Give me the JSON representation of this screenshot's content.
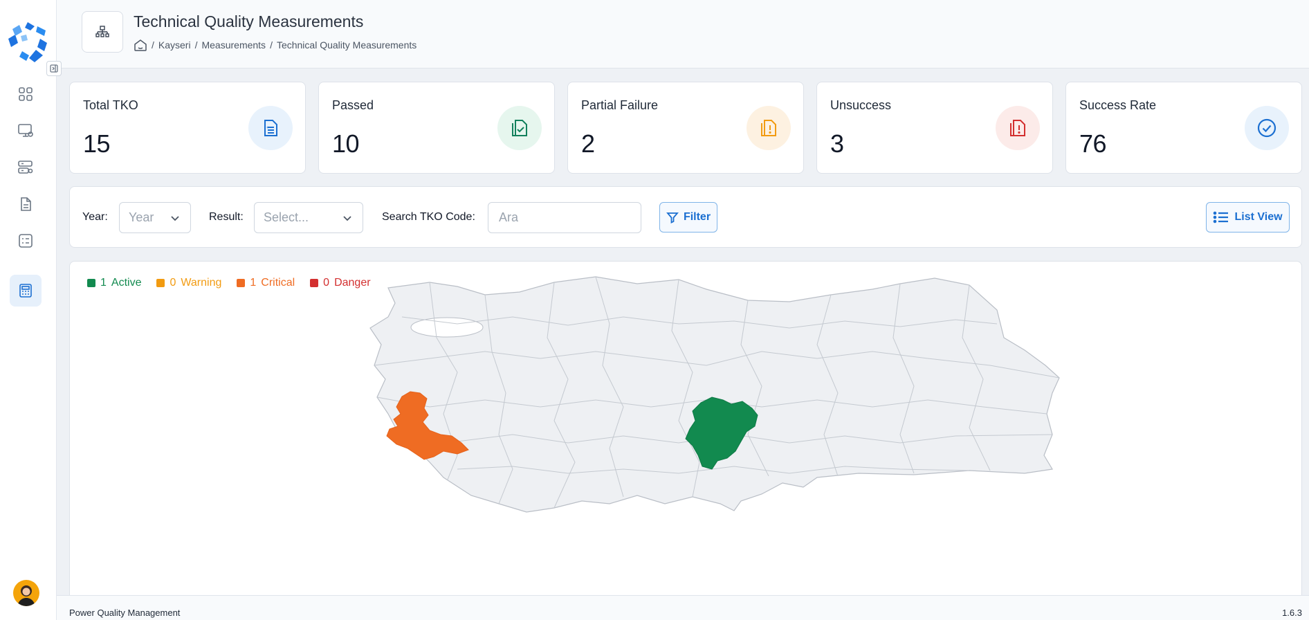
{
  "header": {
    "title": "Technical Quality Measurements",
    "breadcrumb": [
      "Kayseri",
      "Measurements",
      "Technical Quality Measurements"
    ],
    "separator": "/"
  },
  "stats": [
    {
      "label": "Total TKO",
      "value": "15",
      "icon": "document-list-icon",
      "color": "#1b6fd1",
      "bg": "#e8f2fc"
    },
    {
      "label": "Passed",
      "value": "10",
      "icon": "document-check-icon",
      "color": "#12805c",
      "bg": "#e6f6ee"
    },
    {
      "label": "Partial Failure",
      "value": "2",
      "icon": "document-warning-icon",
      "color": "#f29b11",
      "bg": "#fdf1e1"
    },
    {
      "label": "Unsuccess",
      "value": "3",
      "icon": "document-error-icon",
      "color": "#d32f2f",
      "bg": "#fcebe9"
    },
    {
      "label": "Success Rate",
      "value": "76",
      "icon": "check-circle-icon",
      "color": "#1b6fd1",
      "bg": "#e8f2fc"
    }
  ],
  "filters": {
    "year_label": "Year:",
    "year_placeholder": "Year",
    "result_label": "Result:",
    "result_placeholder": "Select...",
    "search_label": "Search TKO Code:",
    "search_placeholder": "Ara",
    "filter_button": "Filter",
    "list_view_button": "List View"
  },
  "legend": [
    {
      "count": "1",
      "label": "Active",
      "color": "#128a4f"
    },
    {
      "count": "0",
      "label": "Warning",
      "color": "#f29b11"
    },
    {
      "count": "1",
      "label": "Critical",
      "color": "#ef6c23"
    },
    {
      "count": "0",
      "label": "Danger",
      "color": "#d32f2f"
    }
  ],
  "map": {
    "highlighted_regions": [
      {
        "name": "Kayseri",
        "status": "Active",
        "color": "#128a4f"
      },
      {
        "name": "İzmir",
        "status": "Critical",
        "color": "#ef6c23"
      }
    ],
    "base_color": "#eef0f3",
    "border_color": "#b9bec6"
  },
  "sidebar": {
    "items": [
      {
        "name": "dashboard-icon",
        "active": false
      },
      {
        "name": "monitor-icon",
        "active": false
      },
      {
        "name": "server-settings-icon",
        "active": false
      },
      {
        "name": "document-icon",
        "active": false
      },
      {
        "name": "list-card-icon",
        "active": false
      },
      {
        "name": "calculator-icon",
        "active": true
      }
    ]
  },
  "footer": {
    "app_name": "Power Quality Management",
    "version": "1.6.3"
  }
}
